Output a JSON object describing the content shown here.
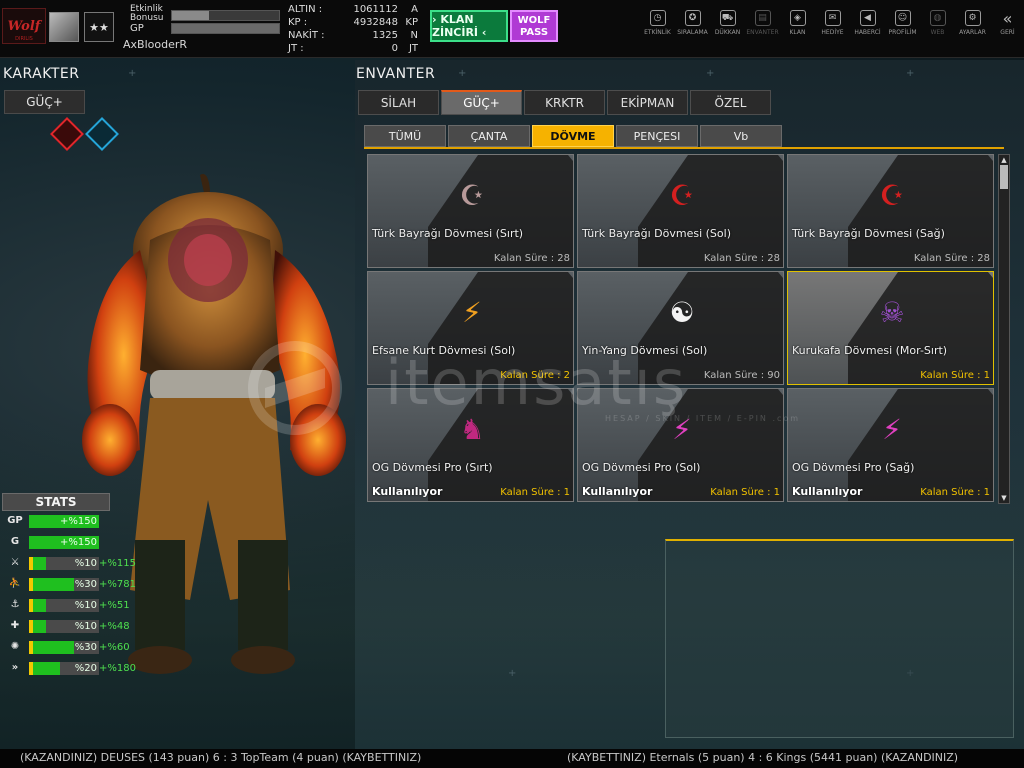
{
  "topbar": {
    "logo_text": "Wolf",
    "logo_sub": "DIRILIS",
    "rank_stars": "★★",
    "etkinlik_label": "Etkinlik Bonusu",
    "gp_label": "GP",
    "etkinlik_fill_pct": 35,
    "gp_fill_pct": 100,
    "username": "AxBlooderR",
    "currencies": [
      {
        "label": "ALTIN :",
        "value": "1061112",
        "unit": "A"
      },
      {
        "label": "KP :",
        "value": "4932848",
        "unit": "KP"
      },
      {
        "label": "NAKİT :",
        "value": "1325",
        "unit": "N"
      },
      {
        "label": "JT :",
        "value": "0",
        "unit": "JT"
      }
    ],
    "klan_button": "› KLAN ZİNCİRİ ‹",
    "wolf_pass_button": "WOLF PASS",
    "nav": [
      {
        "label": "ETKİNLİK",
        "icon": "stopwatch-icon",
        "glyph": "◷",
        "enabled": true
      },
      {
        "label": "SIRALAMA",
        "icon": "ranking-medal-icon",
        "glyph": "✪",
        "enabled": true
      },
      {
        "label": "DÜKKAN",
        "icon": "cart-icon",
        "glyph": "⛟",
        "enabled": true
      },
      {
        "label": "ENVANTER",
        "icon": "inventory-icon",
        "glyph": "▤",
        "enabled": false
      },
      {
        "label": "KLAN",
        "icon": "shield-icon",
        "glyph": "◈",
        "enabled": true
      },
      {
        "label": "HEDİYE",
        "icon": "gift-icon",
        "glyph": "✉",
        "enabled": true
      },
      {
        "label": "HABERCİ",
        "icon": "megaphone-icon",
        "glyph": "◀",
        "enabled": true
      },
      {
        "label": "PROFİLİM",
        "icon": "profile-icon",
        "glyph": "☺",
        "enabled": true
      },
      {
        "label": "WEB",
        "icon": "globe-icon",
        "glyph": "◍",
        "enabled": false
      },
      {
        "label": "AYARLAR",
        "icon": "gear-icon",
        "glyph": "⚙",
        "enabled": true
      },
      {
        "label": "GERİ",
        "icon": "back-icon",
        "glyph": "«",
        "enabled": true
      }
    ]
  },
  "left": {
    "title": "KARAKTER",
    "guc_tab": "GÜÇ+",
    "stats_title": "STATS",
    "stats": [
      {
        "icon_label": "GP",
        "icon": "gp-icon",
        "yellow": 0,
        "green": 100,
        "text": "+%150",
        "extra": ""
      },
      {
        "icon_label": "G",
        "icon": "g-icon",
        "yellow": 0,
        "green": 100,
        "text": "+%150",
        "extra": ""
      },
      {
        "icon_label": "⚔",
        "icon": "attack-icon",
        "yellow": 6,
        "green": 25,
        "text": "%10",
        "extra": "+%115"
      },
      {
        "icon_label": "⛹",
        "icon": "speed-icon",
        "yellow": 6,
        "green": 64,
        "text": "%30",
        "extra": "+%781"
      },
      {
        "icon_label": "⚓",
        "icon": "defense-icon",
        "yellow": 6,
        "green": 25,
        "text": "%10",
        "extra": "+%51"
      },
      {
        "icon_label": "✚",
        "icon": "health-icon",
        "yellow": 6,
        "green": 25,
        "text": "%10",
        "extra": "+%48"
      },
      {
        "icon_label": "✺",
        "icon": "burst-icon",
        "yellow": 6,
        "green": 64,
        "text": "%30",
        "extra": "+%60"
      },
      {
        "icon_label": "»",
        "icon": "dash-icon",
        "yellow": 6,
        "green": 44,
        "text": "%20",
        "extra": "+%180"
      }
    ]
  },
  "inventory": {
    "title": "ENVANTER",
    "tabs": [
      "SİLAH",
      "GÜÇ+",
      "KRKTR",
      "EKİPMAN",
      "ÖZEL"
    ],
    "active_tab": 1,
    "subtabs": [
      "TÜMÜ",
      "ÇANTA",
      "DÖVME",
      "PENÇESI",
      "Vb"
    ],
    "active_subtab": 2,
    "items": [
      {
        "name": "Türk Bayrağı Dövmesi (Sırt)",
        "time": "Kalan Süre : 28",
        "status": "",
        "time_yellow": false,
        "selected": false,
        "glyph": "☪",
        "color": "#b89a9a"
      },
      {
        "name": "Türk Bayrağı Dövmesi (Sol)",
        "time": "Kalan Süre : 28",
        "status": "",
        "time_yellow": false,
        "selected": false,
        "glyph": "☪",
        "color": "#d42020"
      },
      {
        "name": "Türk Bayrağı Dövmesi (Sağ)",
        "time": "Kalan Süre : 28",
        "status": "",
        "time_yellow": false,
        "selected": false,
        "glyph": "☪",
        "color": "#d42020"
      },
      {
        "name": "Efsane Kurt Dövmesi (Sol)",
        "time": "Kalan Süre : 2",
        "status": "",
        "time_yellow": true,
        "selected": false,
        "glyph": "⚡",
        "color": "#f0a020"
      },
      {
        "name": "Yin-Yang Dövmesi (Sol)",
        "time": "Kalan Süre : 90",
        "status": "",
        "time_yellow": false,
        "selected": false,
        "glyph": "☯",
        "color": "#f4f4f4"
      },
      {
        "name": "Kurukafa Dövmesi (Mor-Sırt)",
        "time": "Kalan Süre : 1",
        "status": "",
        "time_yellow": true,
        "selected": true,
        "glyph": "☠",
        "color": "#a050d0"
      },
      {
        "name": "OG Dövmesi Pro (Sırt)",
        "time": "Kalan Süre : 1",
        "status": "Kullanılıyor",
        "time_yellow": true,
        "selected": false,
        "glyph": "♞",
        "color": "#c02880"
      },
      {
        "name": "OG Dövmesi Pro (Sol)",
        "time": "Kalan Süre : 1",
        "status": "Kullanılıyor",
        "time_yellow": true,
        "selected": false,
        "glyph": "⚡",
        "color": "#e040c0"
      },
      {
        "name": "OG Dövmesi Pro (Sağ)",
        "time": "Kalan Süre : 1",
        "status": "Kullanılıyor",
        "time_yellow": true,
        "selected": false,
        "glyph": "⚡",
        "color": "#e040c0"
      }
    ]
  },
  "watermark": {
    "text": "itemsatış",
    "sub": "HESAP / SKIN / ITEM / E-PIN .com"
  },
  "ticker": {
    "left": "(KAZANDINIZ) DEUSES (143 puan) 6 : 3 TopTeam (4 puan) (KAYBETTINIZ)",
    "right": "(KAYBETTINIZ) Eternals (5 puan) 4 : 6 Kings (5441 puan) (KAZANDINIZ)"
  }
}
